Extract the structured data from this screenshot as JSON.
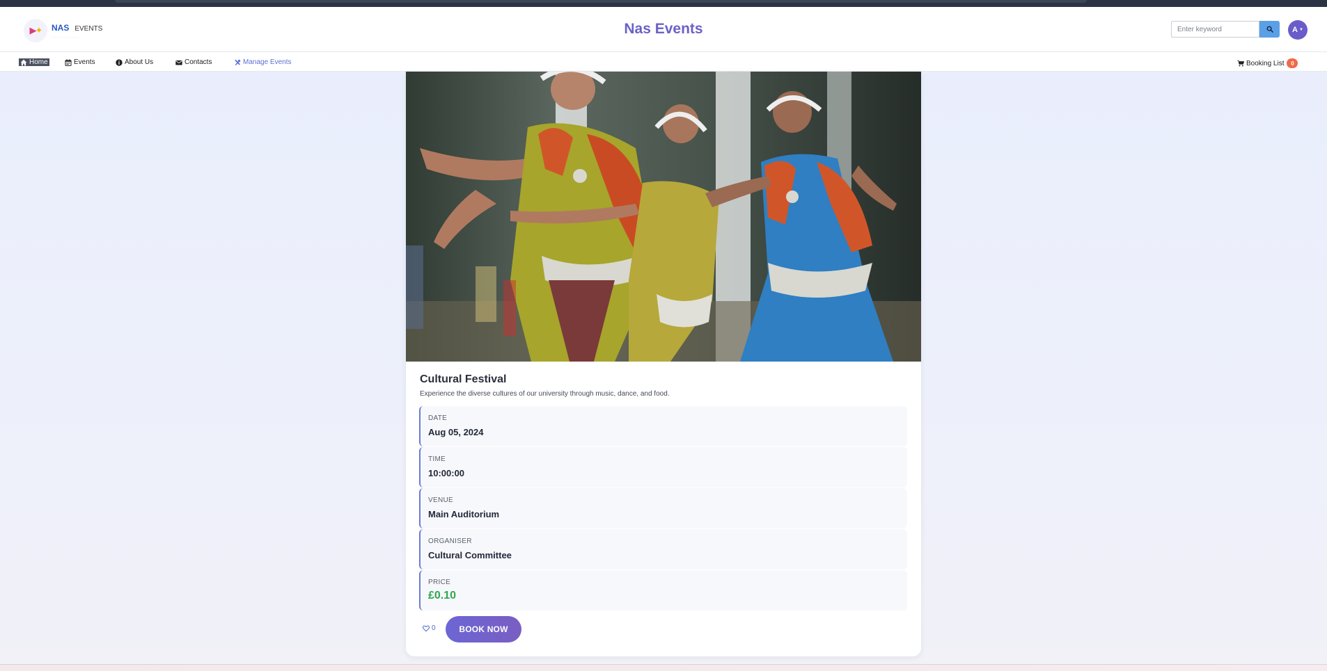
{
  "header": {
    "logo": {
      "brand": "NAS",
      "sub": "EVENTS"
    },
    "site_title": "Nas Events",
    "search": {
      "placeholder": "Enter keyword"
    },
    "avatar_initial": "A"
  },
  "nav": {
    "home": "Home",
    "events": "Events",
    "about": "About Us",
    "contacts": "Contacts",
    "manage": "Manage Events",
    "booking_list": "Booking List",
    "booking_count": "0"
  },
  "event": {
    "title": "Cultural Festival",
    "description": "Experience the diverse cultures of our university through music, dance, and food.",
    "details": [
      {
        "label": "DATE",
        "value": "Aug 05, 2024"
      },
      {
        "label": "TIME",
        "value": "10:00:00"
      },
      {
        "label": "VENUE",
        "value": "Main Auditorium"
      },
      {
        "label": "ORGANISER",
        "value": "Cultural Committee"
      },
      {
        "label": "PRICE",
        "value": "£0.10"
      }
    ],
    "likes": "0",
    "book_label": "BOOK NOW"
  },
  "colors": {
    "accent": "#6a62c7",
    "price": "#2fa84f",
    "badge": "#f06a4a",
    "search_button": "#5b9fe6"
  }
}
